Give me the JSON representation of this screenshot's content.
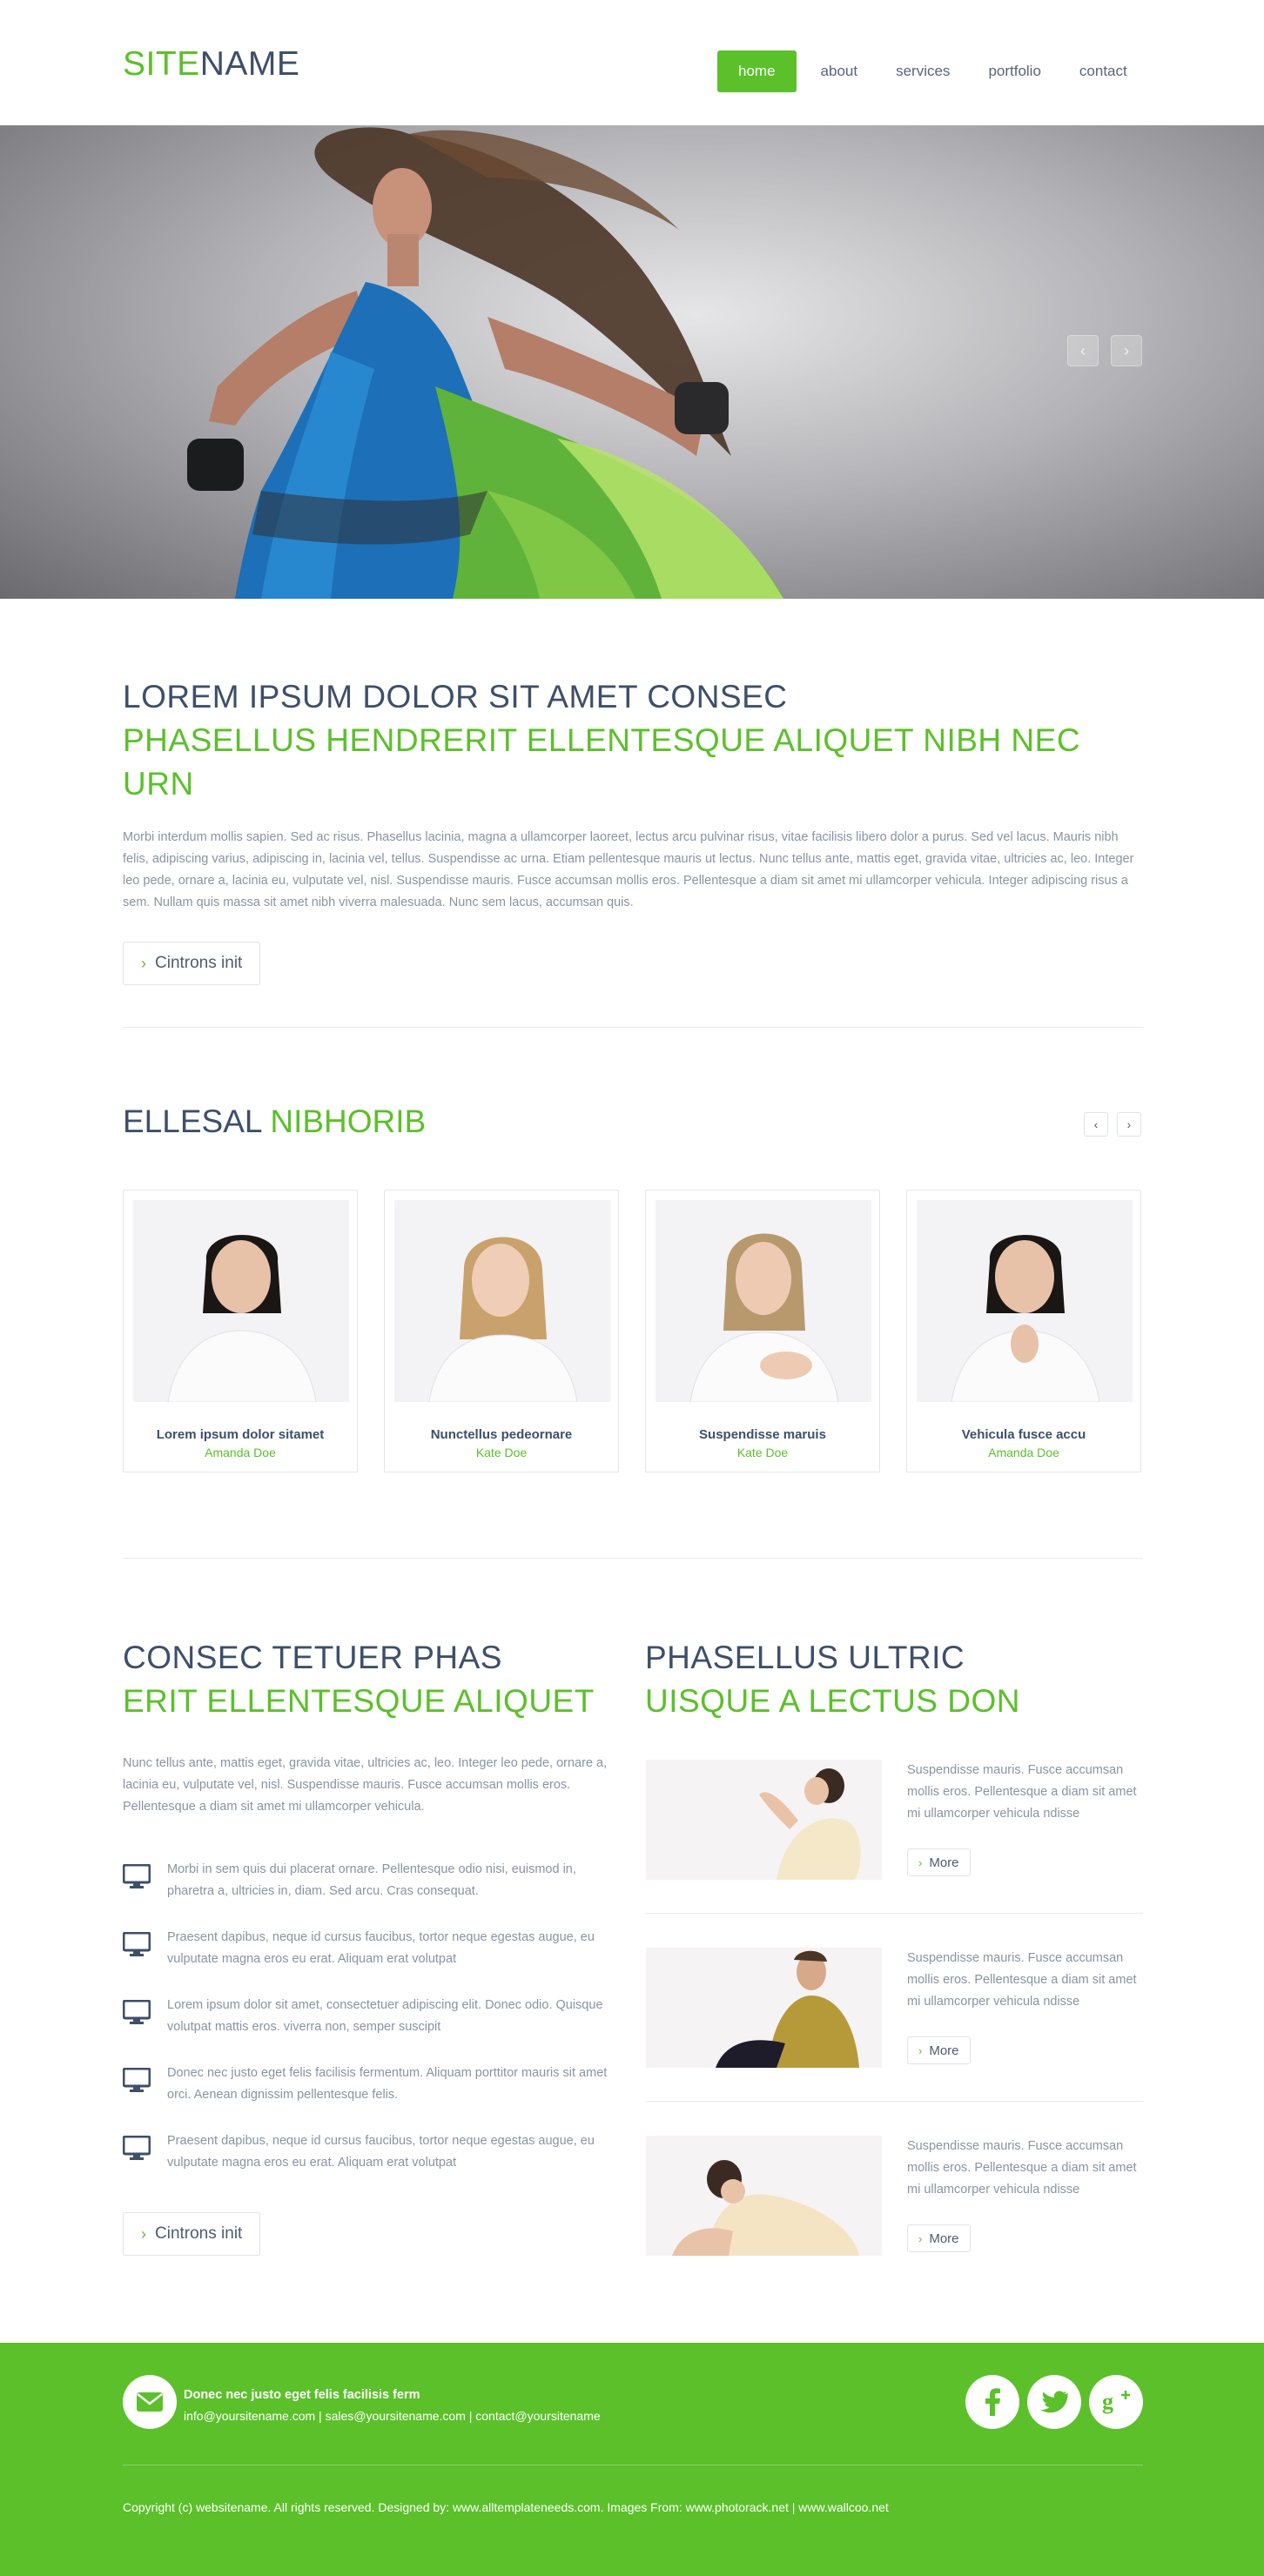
{
  "header": {
    "logo_part1": "SITE",
    "logo_part2": "NAME",
    "nav": [
      "home",
      "about",
      "services",
      "portfolio",
      "contact"
    ]
  },
  "hero": {
    "prev_icon": "chevron-left-icon",
    "next_icon": "chevron-right-icon"
  },
  "intro": {
    "title": "LOREM IPSUM DOLOR SIT AMET CONSEC",
    "subtitle": "PHASELLUS HENDRERIT ELLENTESQUE ALIQUET NIBH NEC URN",
    "body": "Morbi interdum mollis sapien. Sed ac risus. Phasellus lacinia, magna a ullamcorper laoreet, lectus arcu pulvinar risus, vitae facilisis libero dolor a purus. Sed vel lacus. Mauris nibh felis, adipiscing varius, adipiscing in, lacinia vel, tellus. Suspendisse ac urna. Etiam pellentesque mauris ut lectus. Nunc tellus ante, mattis eget, gravida vitae, ultricies ac, leo. Integer leo pede, ornare a, lacinia eu, vulputate vel, nisl. Suspendisse mauris. Fusce accumsan mollis eros. Pellentesque a diam sit amet mi ullamcorper vehicula. Integer adipiscing risus a sem. Nullam quis massa sit amet nibh viverra malesuada. Nunc sem lacus, accumsan quis.",
    "button": "Cintrons init"
  },
  "team": {
    "title_part1": "ELLESAL",
    "title_part2": "NIBHORIB",
    "members": [
      {
        "name": "Lorem ipsum dolor sitamet",
        "role": "Amanda Doe"
      },
      {
        "name": "Nunctellus pedeornare",
        "role": "Kate Doe"
      },
      {
        "name": "Suspendisse maruis",
        "role": "Kate Doe"
      },
      {
        "name": "Vehicula fusce accu",
        "role": "Amanda Doe"
      }
    ]
  },
  "left_col": {
    "title": "CONSEC TETUER PHAS",
    "subtitle": "ERIT ELLENTESQUE ALIQUET",
    "body": "Nunc tellus ante, mattis eget, gravida vitae, ultricies ac, leo. Integer leo pede, ornare a, lacinia eu, vulputate vel, nisl. Suspendisse mauris. Fusce accumsan mollis eros. Pellentesque a diam sit amet mi ullamcorper vehicula.",
    "features": [
      "Morbi in sem quis dui placerat ornare. Pellentesque odio nisi, euismod in, pharetra a, ultricies in, diam. Sed arcu. Cras consequat.",
      "Praesent dapibus, neque id cursus faucibus, tortor neque egestas augue, eu vulputate magna eros eu erat. Aliquam erat volutpat",
      "Lorem ipsum dolor sit amet, consectetuer adipiscing elit. Donec odio. Quisque volutpat mattis eros. viverra non, semper suscipit",
      "Donec nec justo eget felis facilisis fermentum. Aliquam porttitor mauris sit amet orci. Aenean dignissim pellentesque felis.",
      "Praesent dapibus, neque id cursus faucibus, tortor neque egestas augue, eu vulputate magna eros eu erat. Aliquam erat volutpat"
    ],
    "feature_icon": "monitor-icon",
    "button": "Cintrons init"
  },
  "right_col": {
    "title": "PHASELLUS ULTRIC",
    "subtitle": "UISQUE A LECTUS DON",
    "posts": [
      {
        "text": "Suspendisse mauris. Fusce accumsan mollis eros. Pellentesque a diam sit amet mi ullamcorper vehicula ndisse",
        "more": "More"
      },
      {
        "text": "Suspendisse mauris. Fusce accumsan mollis eros. Pellentesque a diam sit amet mi ullamcorper vehicula ndisse",
        "more": "More"
      },
      {
        "text": "Suspendisse mauris. Fusce accumsan mollis eros. Pellentesque a diam sit amet mi ullamcorper vehicula ndisse",
        "more": "More"
      }
    ]
  },
  "footer": {
    "contact_title": "Donec nec justo eget felis facilisis ferm",
    "emails": "info@yoursitename.com  |  sales@yoursitename.com  |  contact@yoursitename",
    "copyright": "Copyright (c) websitename. All rights reserved.  Designed by: www.alltemplateneeds.com.  Images From: www.photorack.net  |  www.wallcoo.net",
    "social": [
      "facebook-icon",
      "twitter-icon",
      "google-plus-icon"
    ]
  },
  "colors": {
    "accent": "#5bc02a",
    "heading": "#3e4f6a",
    "text": "#8a93a3"
  }
}
